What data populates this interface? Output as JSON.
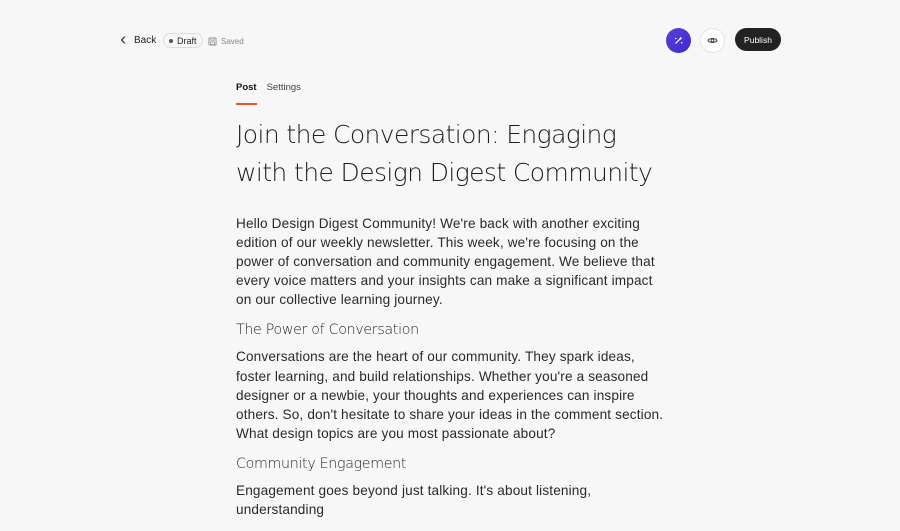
{
  "header": {
    "back_label": "Back",
    "status_badge": "Draft",
    "save_status": "Saved",
    "publish_label": "Publish"
  },
  "tabs": [
    {
      "label": "Post",
      "active": true
    },
    {
      "label": "Settings",
      "active": false
    }
  ],
  "post": {
    "title": "Join the Conversation: Engaging with the Design Digest Community",
    "intro": "Hello Design Digest Community! We're back with another exciting edition of our weekly newsletter. This week, we're focusing on the power of conversation and community engagement. We believe that every voice matters and your insights can make a significant impact on our collective learning journey.",
    "section1_heading": "The Power of Conversation",
    "section1_body": "Conversations are the heart of our community. They spark ideas, foster learning, and build relationships. Whether you're a seasoned designer or a newbie, your thoughts and experiences can inspire others. So, don't hesitate to share your ideas in the comment section. What design topics are you most passionate about?",
    "section2_heading": "Community Engagement",
    "section2_body": "Engagement goes beyond just talking. It's about listening, understanding"
  },
  "colors": {
    "accent": "#e8562a",
    "ai_button": "#4a35d4",
    "publish_bg": "#222222",
    "page_bg": "#f7f7f7"
  },
  "icons": {
    "back": "chevron-left-icon",
    "save": "floppy-disk-icon",
    "ai": "sparkle-icon",
    "preview": "eye-icon"
  }
}
